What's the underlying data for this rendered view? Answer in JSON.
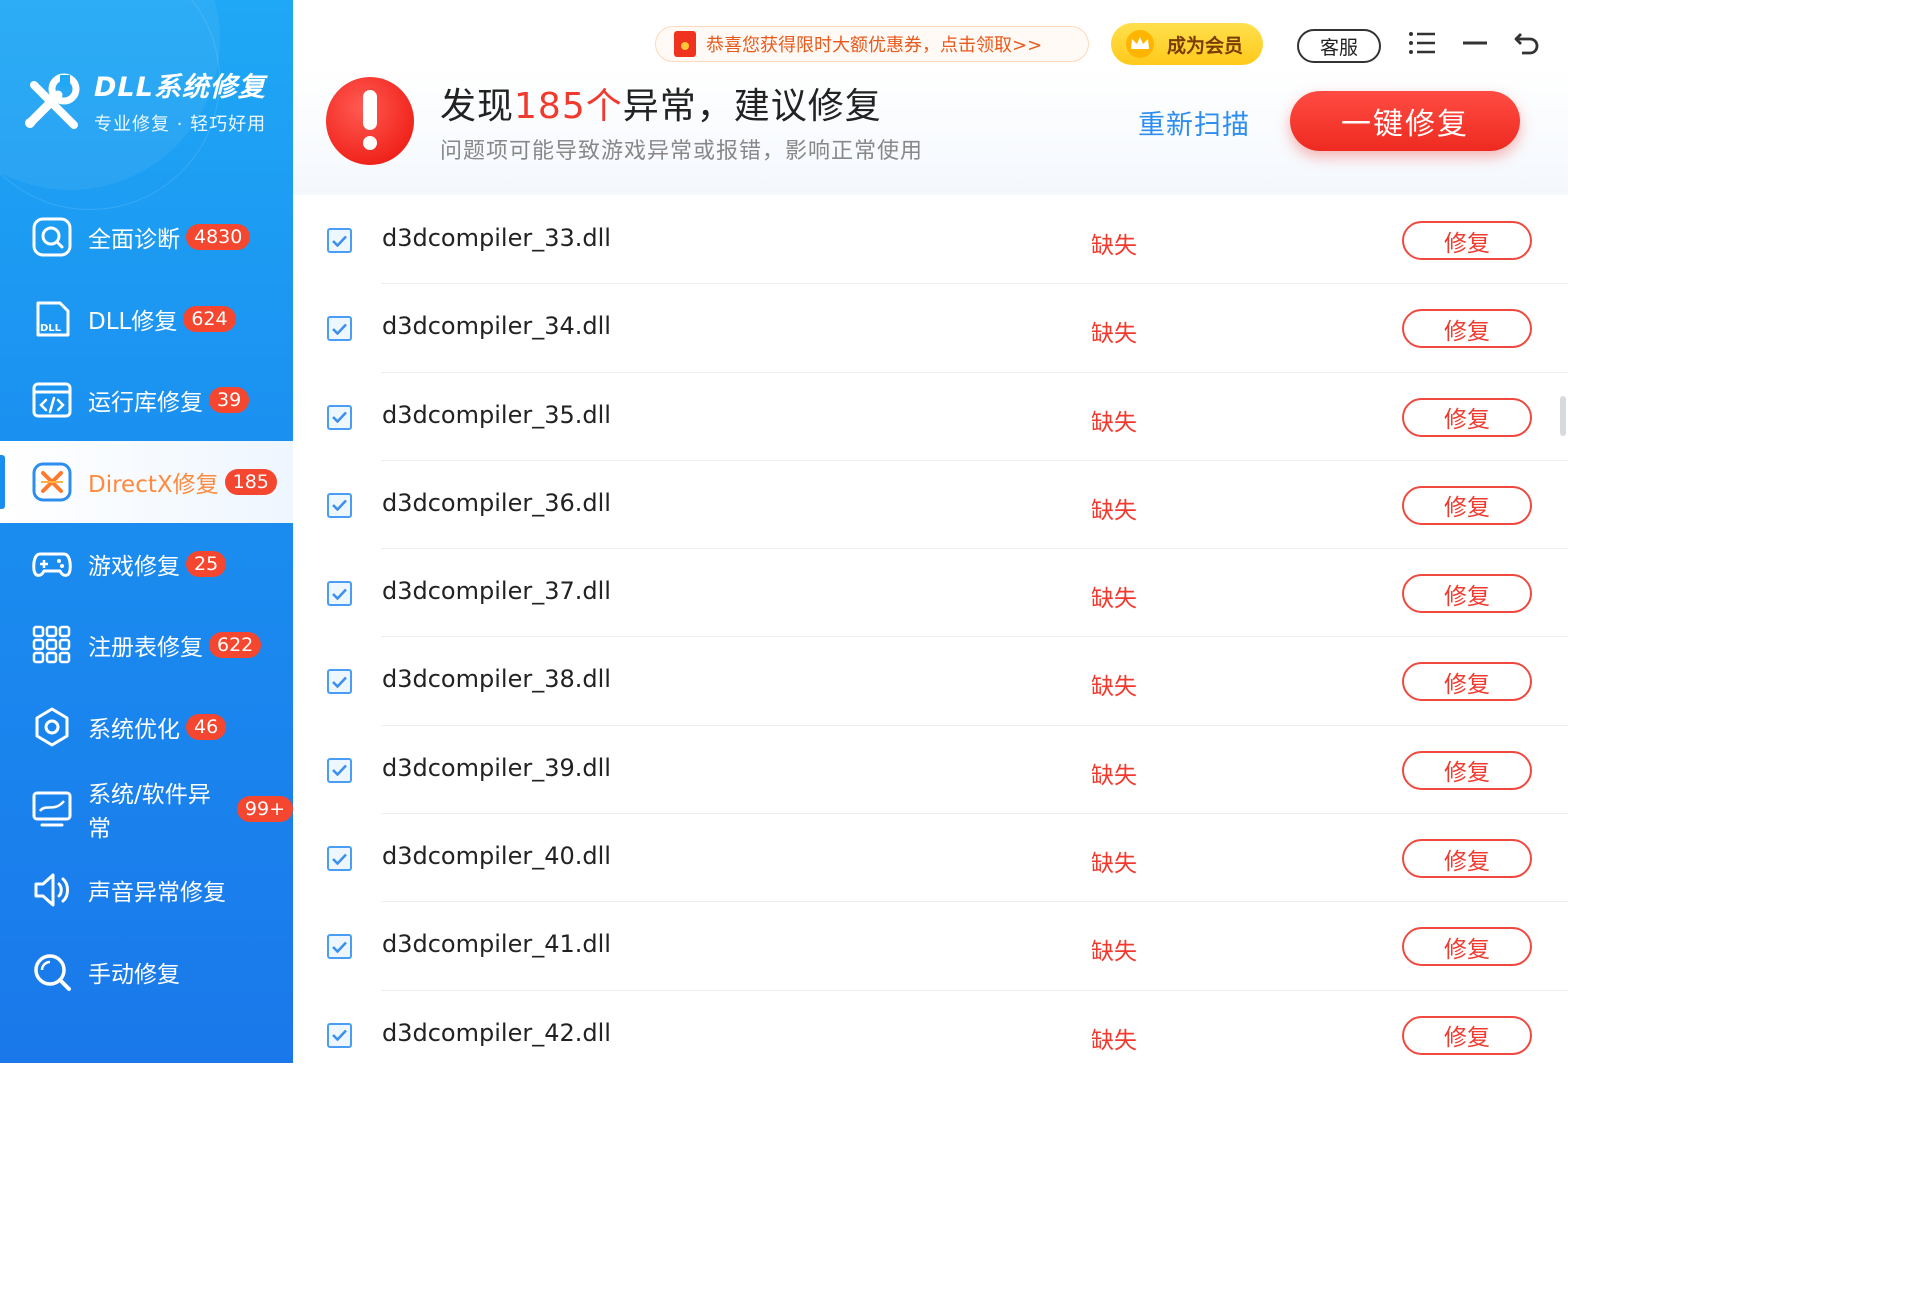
{
  "brand": {
    "name": "DLL系统修复",
    "slogan": "专业修复 · 轻巧好用"
  },
  "sidebar": {
    "items": [
      {
        "label": "全面诊断",
        "badge": "4830",
        "icon": "search-icon"
      },
      {
        "label": "DLL修复",
        "badge": "624",
        "icon": "dll-file-icon"
      },
      {
        "label": "运行库修复",
        "badge": "39",
        "icon": "code-window-icon"
      },
      {
        "label": "DirectX修复",
        "badge": "185",
        "icon": "directx-icon",
        "active": true
      },
      {
        "label": "游戏修复",
        "badge": "25",
        "icon": "gamepad-icon"
      },
      {
        "label": "注册表修复",
        "badge": "622",
        "icon": "grid-icon"
      },
      {
        "label": "系统优化",
        "badge": "46",
        "icon": "gear-icon"
      },
      {
        "label": "系统/软件异常",
        "badge": "99+",
        "icon": "monitor-icon"
      },
      {
        "label": "声音异常修复",
        "badge": "",
        "icon": "speaker-icon"
      },
      {
        "label": "手动修复",
        "badge": "",
        "icon": "manual-search-icon"
      }
    ]
  },
  "topbar": {
    "promo_text": "恭喜您获得限时大额优惠券，点击领取>>",
    "vip_label": "成为会员",
    "support_label": "客服"
  },
  "header": {
    "title_prefix": "发现",
    "title_count": "185个",
    "title_suffix": "异常，建议修复",
    "subtitle": "问题项可能导致游戏异常或报错，影响正常使用",
    "rescan_label": "重新扫描",
    "fix_all_label": "一键修复"
  },
  "list": {
    "rows": [
      {
        "file": "d3dcompiler_33.dll",
        "status": "缺失",
        "action": "修复",
        "checked": true
      },
      {
        "file": "d3dcompiler_34.dll",
        "status": "缺失",
        "action": "修复",
        "checked": true
      },
      {
        "file": "d3dcompiler_35.dll",
        "status": "缺失",
        "action": "修复",
        "checked": true
      },
      {
        "file": "d3dcompiler_36.dll",
        "status": "缺失",
        "action": "修复",
        "checked": true
      },
      {
        "file": "d3dcompiler_37.dll",
        "status": "缺失",
        "action": "修复",
        "checked": true
      },
      {
        "file": "d3dcompiler_38.dll",
        "status": "缺失",
        "action": "修复",
        "checked": true
      },
      {
        "file": "d3dcompiler_39.dll",
        "status": "缺失",
        "action": "修复",
        "checked": true
      },
      {
        "file": "d3dcompiler_40.dll",
        "status": "缺失",
        "action": "修复",
        "checked": true
      },
      {
        "file": "d3dcompiler_41.dll",
        "status": "缺失",
        "action": "修复",
        "checked": true
      },
      {
        "file": "d3dcompiler_42.dll",
        "status": "缺失",
        "action": "修复",
        "checked": true
      }
    ]
  },
  "colors": {
    "accent_red": "#f03a2e",
    "sidebar_blue": "#1a8ef0",
    "link_blue": "#2e8ef0",
    "vip_gold": "#ffc91a"
  }
}
